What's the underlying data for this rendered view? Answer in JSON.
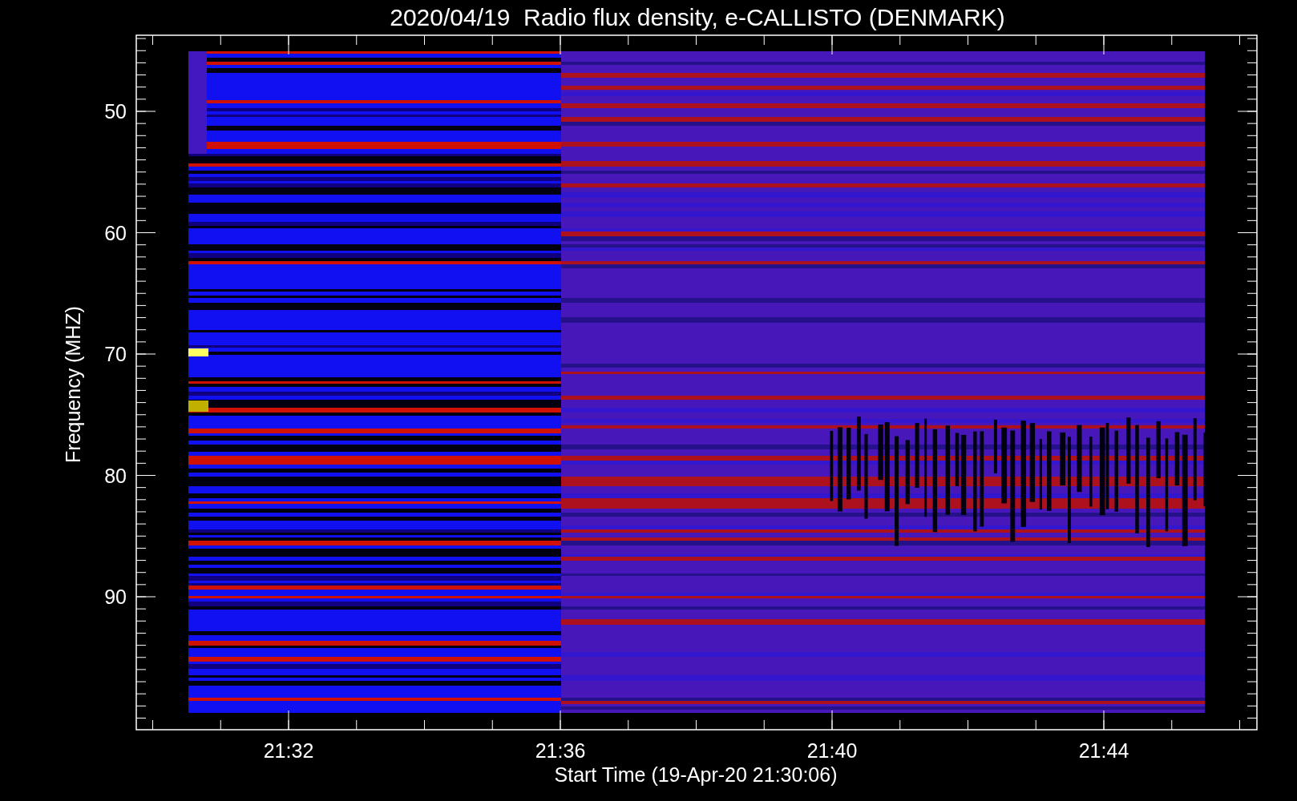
{
  "title": "2020/04/19  Radio flux density, e-CALLISTO (DENMARK)",
  "x_axis": {
    "label": "Start Time (19-Apr-20 21:30:06)",
    "ticks": [
      "21:32",
      "21:36",
      "21:40",
      "21:44"
    ]
  },
  "y_axis": {
    "label": "Frequency (MHZ)",
    "ticks": [
      "50",
      "60",
      "70",
      "80",
      "90"
    ]
  }
}
